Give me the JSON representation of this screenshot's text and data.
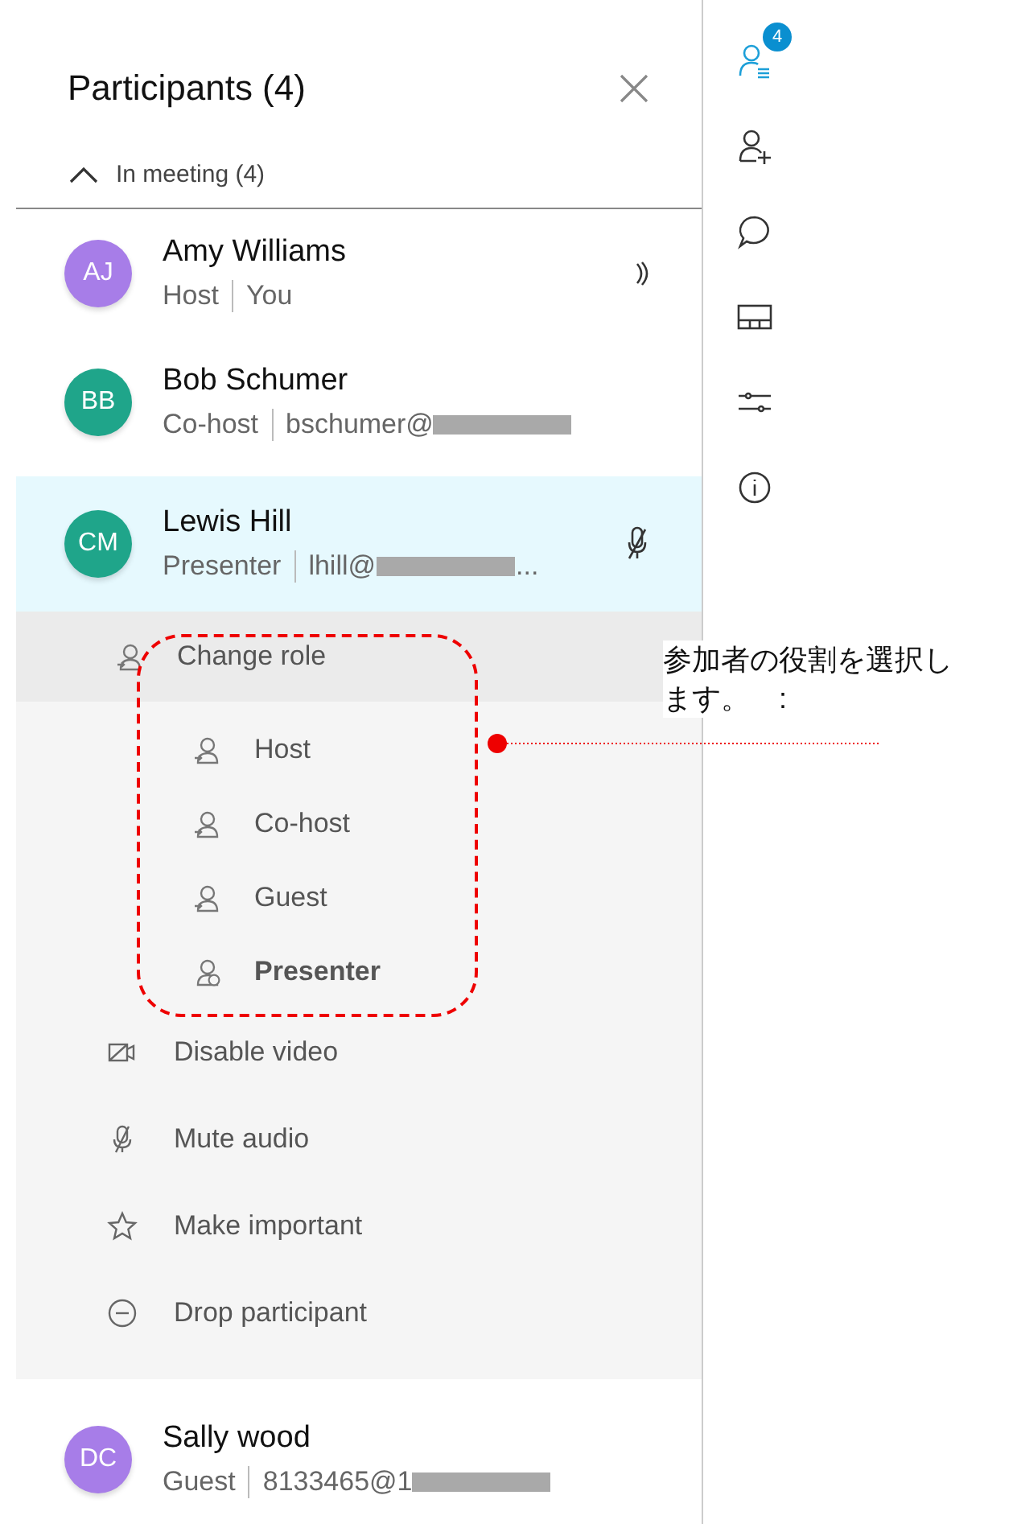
{
  "panel": {
    "title": "Participants (4)",
    "section": {
      "label": "In meeting (4)",
      "expanded": true
    }
  },
  "participants": [
    {
      "initials": "AJ",
      "color": "#a77de8",
      "name": "Amy Williams",
      "role": "Host",
      "detail": "You",
      "redacted": false,
      "speaking": true,
      "muted": false,
      "selected": false
    },
    {
      "initials": "BB",
      "color": "#1fa58a",
      "name": "Bob Schumer",
      "role": "Co-host",
      "detail": "bschumer@",
      "redacted": true,
      "speaking": false,
      "muted": false,
      "selected": false
    },
    {
      "initials": "CM",
      "color": "#1fa58a",
      "name": "Lewis Hill",
      "role": "Presenter",
      "detail": "lhill@",
      "redacted": true,
      "detail_end": "...",
      "speaking": false,
      "muted": true,
      "selected": true
    }
  ],
  "menu": {
    "header": {
      "label": "Change role"
    },
    "roles": [
      {
        "label": "Host",
        "selected": false
      },
      {
        "label": "Co-host",
        "selected": false
      },
      {
        "label": "Guest",
        "selected": false
      },
      {
        "label": "Presenter",
        "selected": true
      }
    ],
    "actions": [
      {
        "kind": "video",
        "label": "Disable video"
      },
      {
        "kind": "mute",
        "label": "Mute audio"
      },
      {
        "kind": "star",
        "label": "Make important"
      },
      {
        "kind": "drop",
        "label": "Drop participant"
      }
    ]
  },
  "last_participant": {
    "initials": "DC",
    "color": "#a77de8",
    "name": "Sally wood",
    "role": "Guest",
    "detail": "8133465@1",
    "redacted": true,
    "selected": false
  },
  "rail": {
    "badge": "4",
    "items": [
      {
        "kind": "participants",
        "selected": true
      },
      {
        "kind": "add-person",
        "selected": false
      },
      {
        "kind": "chat",
        "selected": false
      },
      {
        "kind": "layout",
        "selected": false
      },
      {
        "kind": "settings",
        "selected": false
      },
      {
        "kind": "info",
        "selected": false
      }
    ]
  },
  "annotation": {
    "lines": [
      "参加者の役割を選択し",
      "ます。　:"
    ]
  }
}
